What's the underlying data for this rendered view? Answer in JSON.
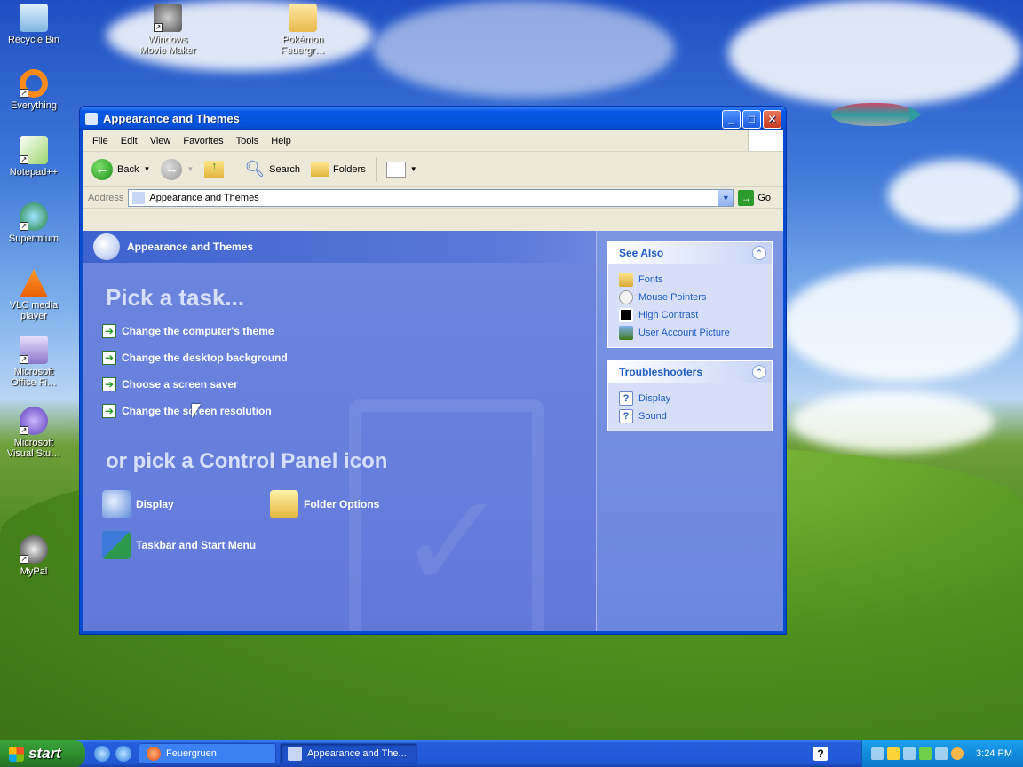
{
  "desktop": {
    "icons": [
      {
        "label": "Recycle Bin"
      },
      {
        "label": "Windows Movie Maker"
      },
      {
        "label": "Pokémon Feuergr…"
      },
      {
        "label": "Everything"
      },
      {
        "label": "Notepad++"
      },
      {
        "label": "Supermium"
      },
      {
        "label": "VLC media player"
      },
      {
        "label": "Microsoft Office Fi…"
      },
      {
        "label": "Microsoft Visual Stu…"
      },
      {
        "label": "MyPal"
      }
    ]
  },
  "window": {
    "title": "Appearance and Themes",
    "controls": {
      "minimize": "_",
      "maximize": "□",
      "close": "✕"
    },
    "menu": [
      "File",
      "Edit",
      "View",
      "Favorites",
      "Tools",
      "Help"
    ],
    "toolbar": {
      "back": "Back",
      "search": "Search",
      "folders": "Folders"
    },
    "address": {
      "label": "Address",
      "value": "Appearance and Themes",
      "go": "Go"
    },
    "main": {
      "banner_title": "Appearance and Themes",
      "pick_task_heading": "Pick a task...",
      "tasks": [
        "Change the computer's theme",
        "Change the desktop background",
        "Choose a screen saver",
        "Change the screen resolution"
      ],
      "pick_icon_heading": "or pick a Control Panel icon",
      "icons": [
        "Display",
        "Folder Options",
        "Taskbar and Start Menu"
      ]
    },
    "sidebar": {
      "see_also": {
        "title": "See Also",
        "links": [
          "Fonts",
          "Mouse Pointers",
          "High Contrast",
          "User Account Picture"
        ]
      },
      "troubleshooters": {
        "title": "Troubleshooters",
        "links": [
          "Display",
          "Sound"
        ]
      }
    }
  },
  "taskbar": {
    "start_label": "start",
    "tasks": [
      {
        "label": "Feuergruen"
      },
      {
        "label": "Appearance and The..."
      }
    ],
    "clock": "3:24 PM"
  }
}
